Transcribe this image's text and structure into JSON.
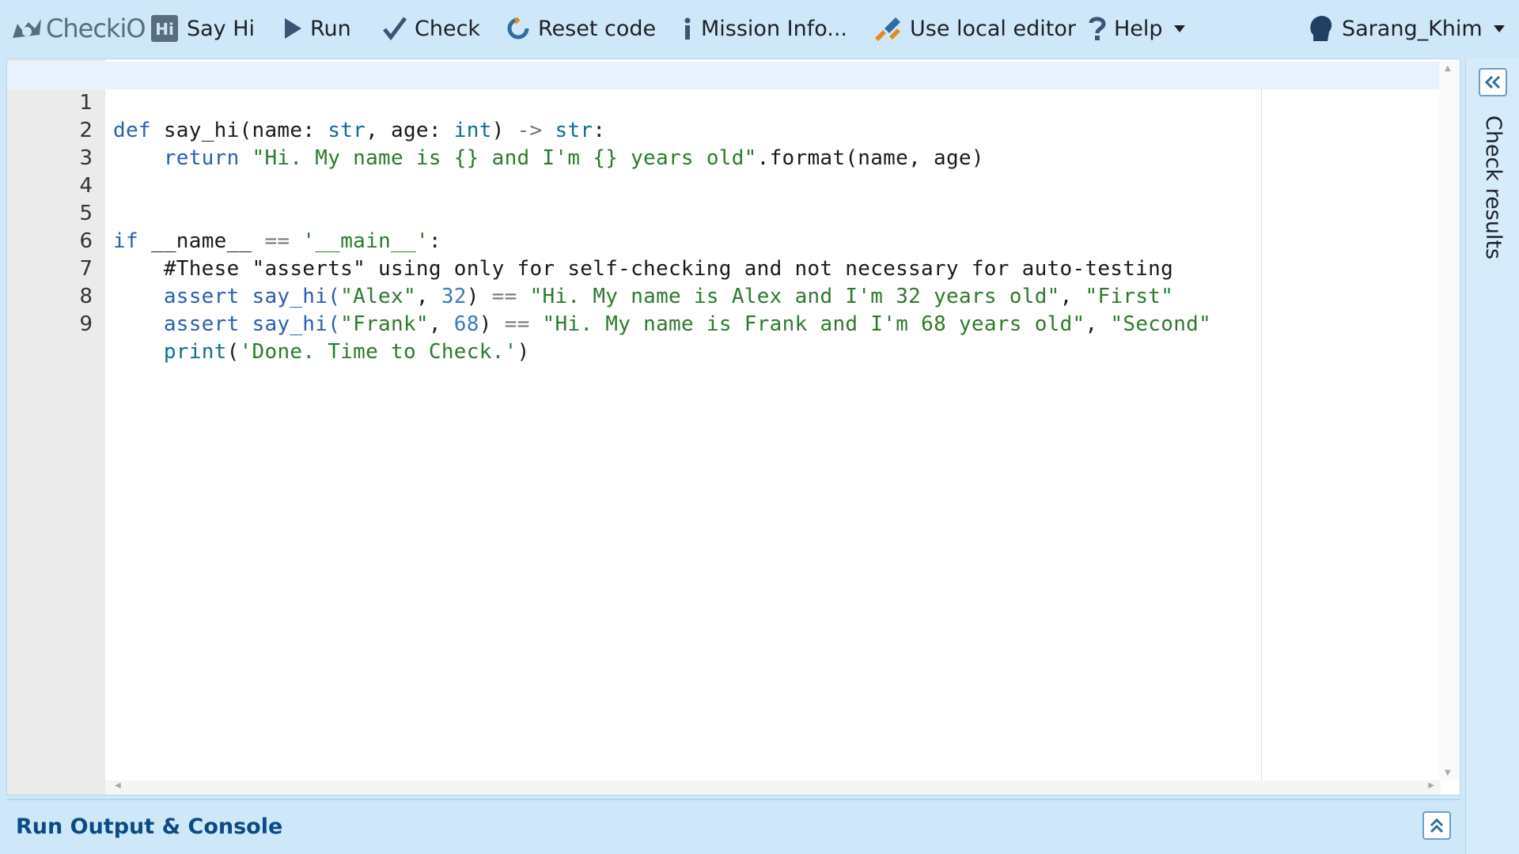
{
  "toolbar": {
    "logo_text": "CheckiO",
    "mission_label": "Say Hi",
    "run_label": "Run",
    "check_label": "Check",
    "reset_label": "Reset code",
    "info_label": "Mission Info...",
    "local_label": "Use local editor",
    "help_label": "Help",
    "user_label": "Sarang_Khim"
  },
  "editor": {
    "lines": [
      {
        "n": "1"
      },
      {
        "n": "2"
      },
      {
        "n": "3"
      },
      {
        "n": "4"
      },
      {
        "n": "5"
      },
      {
        "n": "6"
      },
      {
        "n": "7"
      },
      {
        "n": "8"
      },
      {
        "n": "9"
      }
    ],
    "code": {
      "l1": [
        "def",
        " say_hi(name: ",
        "str",
        ", age: ",
        "int",
        ") ",
        "->",
        " ",
        "str",
        ":"
      ],
      "l2": [
        "    return ",
        "\"Hi. My name is {} and I'm {} years old\"",
        ".format(name, age)"
      ],
      "l5": [
        "if",
        " __name__ ",
        "==",
        " ",
        "'__main__'",
        ":"
      ],
      "l6": [
        "    #These \"asserts\" using only for self-checking and not necessary for auto-testing"
      ],
      "l7": [
        "    assert say_hi(",
        "\"Alex\"",
        ", ",
        "32",
        ") ",
        "==",
        " ",
        "\"Hi. My name is Alex and I'm 32 years old\"",
        ", ",
        "\"First\""
      ],
      "l8": [
        "    assert say_hi(",
        "\"Frank\"",
        ", ",
        "68",
        ") ",
        "==",
        " ",
        "\"Hi. My name is Frank and I'm 68 years old\"",
        ", ",
        "\"Second\""
      ],
      "l9": [
        "    ",
        "print",
        "(",
        "'Done. Time to Check.'",
        ")"
      ]
    }
  },
  "side_panel": {
    "title": "Check results"
  },
  "console": {
    "title": "Run Output & Console"
  },
  "colors": {
    "toolbar_bg": "#cfe8f9",
    "console_title": "#0b4a84",
    "accent": "#6c9fc6"
  }
}
